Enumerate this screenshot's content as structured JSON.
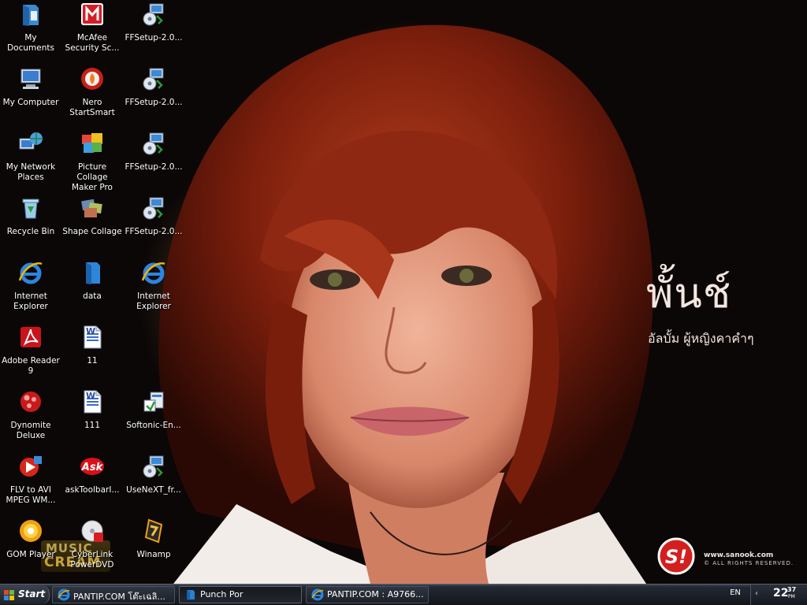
{
  "desktop": {
    "wallpaper": {
      "brand_name": "พั้นช์",
      "brand_subtitle": "อัลบั้ม  ผู้หญิงคาคำๆ",
      "publisher_logo": "S!",
      "publisher_url": "www.sanook.com",
      "publisher_rights": "© ALL RIGHTS RESERVED.",
      "music_logo_line1": "MUSIC",
      "music_logo_line2": "CREAM"
    },
    "icons": [
      {
        "id": "my-documents",
        "label": "My Documents",
        "icon": "documents-folder-icon"
      },
      {
        "id": "mcafee",
        "label": "McAfee\nSecurity Sc...",
        "icon": "mcafee-icon"
      },
      {
        "id": "ffsetup-1",
        "label": "FFSetup-2.0...",
        "icon": "installer-icon"
      },
      {
        "id": "my-computer",
        "label": "My Computer",
        "icon": "computer-icon"
      },
      {
        "id": "nero",
        "label": "Nero\nStartSmart",
        "icon": "nero-icon"
      },
      {
        "id": "ffsetup-2",
        "label": "FFSetup-2.0...",
        "icon": "installer-icon"
      },
      {
        "id": "my-network-places",
        "label": "My Network\nPlaces",
        "icon": "network-icon"
      },
      {
        "id": "picture-collage",
        "label": "Picture Collage\nMaker Pro",
        "icon": "collage-icon"
      },
      {
        "id": "ffsetup-3",
        "label": "FFSetup-2.0...",
        "icon": "installer-icon"
      },
      {
        "id": "recycle-bin",
        "label": "Recycle Bin",
        "icon": "recycle-bin-icon"
      },
      {
        "id": "shape-collage",
        "label": "Shape Collage",
        "icon": "shape-collage-icon"
      },
      {
        "id": "ffsetup-4",
        "label": "FFSetup-2.0...",
        "icon": "installer-icon"
      },
      {
        "id": "internet-explorer-1",
        "label": "Internet\nExplorer",
        "icon": "ie-icon"
      },
      {
        "id": "data",
        "label": "data",
        "icon": "folder-icon"
      },
      {
        "id": "internet-explorer-2",
        "label": "Internet\nExplorer",
        "icon": "ie-icon"
      },
      {
        "id": "adobe-reader",
        "label": "Adobe Reader\n9",
        "icon": "adobe-reader-icon"
      },
      {
        "id": "doc-11",
        "label": "11",
        "icon": "word-document-icon"
      },
      {
        "id": "dynomite",
        "label": "Dynomite\nDeluxe",
        "icon": "dynomite-icon"
      },
      {
        "id": "doc-111",
        "label": "111",
        "icon": "word-document-icon"
      },
      {
        "id": "softonic",
        "label": "Softonic-En...",
        "icon": "softonic-installer-icon"
      },
      {
        "id": "flv-to-avi",
        "label": "FLV to AVI\nMPEG WM...",
        "icon": "video-converter-icon"
      },
      {
        "id": "ask-toolbar",
        "label": "askToolbarI...",
        "icon": "ask-icon"
      },
      {
        "id": "usenext",
        "label": "UseNeXT_fr...",
        "icon": "installer-icon"
      },
      {
        "id": "gom-player",
        "label": "GOM Player",
        "icon": "gom-player-icon"
      },
      {
        "id": "cyberlink",
        "label": "CyberLink\nPowerDVD",
        "icon": "dvd-icon"
      },
      {
        "id": "winamp",
        "label": "Winamp",
        "icon": "winamp-icon"
      }
    ]
  },
  "taskbar": {
    "start_label": "Start",
    "tasks": [
      {
        "label": "PANTIP.COM โต๊ะเฉลิ...",
        "icon": "ie-icon",
        "active": false
      },
      {
        "label": "Punch Por",
        "icon": "folder-icon",
        "active": true
      },
      {
        "label": "PANTIP.COM : A9766...",
        "icon": "ie-icon",
        "active": false
      }
    ],
    "language": "EN",
    "clock_hour": "22",
    "clock_minute": "37",
    "clock_ampm": "PM"
  },
  "colors": {
    "taskbar": "#1b1f27",
    "accent_red": "#d41f1f",
    "ie_blue": "#1e6fd0"
  }
}
